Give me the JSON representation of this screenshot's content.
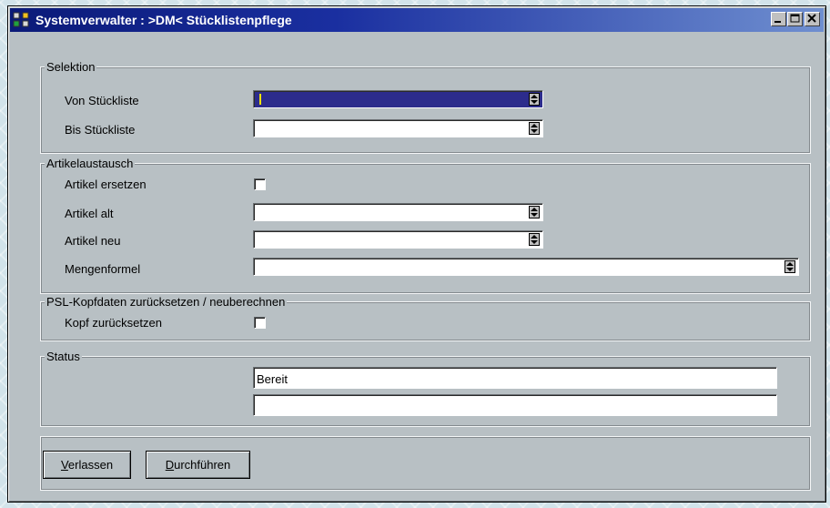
{
  "window": {
    "title": "Systemverwalter :  >DM< Stücklistenpflege",
    "controls": [
      "minimize-icon",
      "maximize-icon",
      "close-icon"
    ]
  },
  "selektion": {
    "legend": "Selektion",
    "von_label": "Von Stückliste",
    "von_value": "",
    "bis_label": "Bis Stückliste",
    "bis_value": ""
  },
  "artikelaustausch": {
    "legend": "Artikelaustausch",
    "ersetzen_label": "Artikel ersetzen",
    "ersetzen_checked": false,
    "alt_label": "Artikel alt",
    "alt_value": "",
    "neu_label": "Artikel neu",
    "neu_value": "",
    "mengen_label": "Mengenformel",
    "mengen_value": ""
  },
  "kopf": {
    "legend": "PSL-Kopfdaten zurücksetzen / neuberechnen",
    "zuruck_label": "Kopf zurücksetzen",
    "zuruck_checked": false
  },
  "status": {
    "legend": "Status",
    "line1": "Bereit",
    "line2": ""
  },
  "buttons": {
    "verlassen_mnemonic": "V",
    "verlassen_rest": "erlassen",
    "durchfuehren_mnemonic": "D",
    "durchfuehren_rest": "urchführen"
  },
  "colors": {
    "titlebar_start": "#0b1a78",
    "titlebar_end": "#6f8fd0",
    "window_bg": "#b8c0c4",
    "selected_field": "#2c2c8c"
  }
}
